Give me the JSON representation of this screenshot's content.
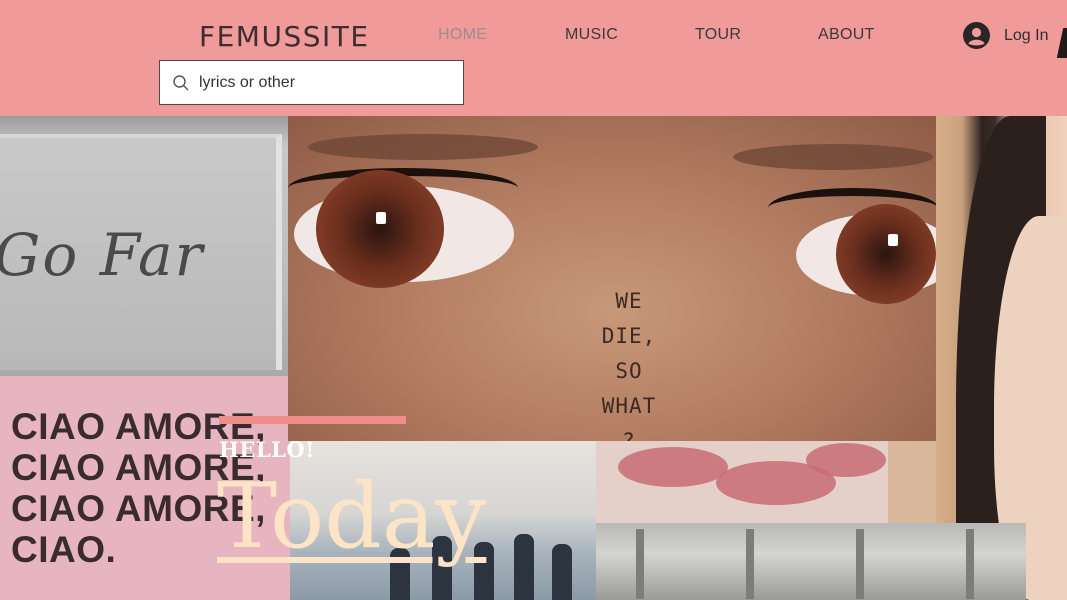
{
  "header": {
    "logo": "FEMUSSITE",
    "nav": [
      {
        "label": "HOME",
        "active": true
      },
      {
        "label": "MUSIC",
        "active": false
      },
      {
        "label": "TOUR",
        "active": false
      },
      {
        "label": "ABOUT",
        "active": false
      }
    ],
    "login_label": "Log In",
    "search": {
      "value": "lyrics or other"
    }
  },
  "hero": {
    "sign_text": "Go Far",
    "ciao_lines": [
      "CIAO AMORE,",
      "CIAO AMORE,",
      "CIAO AMORE,",
      "CIAO."
    ],
    "face_text": [
      "WE DIE,",
      "SO",
      "WHAT",
      "?"
    ],
    "eyebrow": "HELLO!",
    "headline": "Today"
  },
  "colors": {
    "header_bg": "#f09a9a",
    "accent": "#ef8f8c",
    "headline": "#fde4c6"
  }
}
